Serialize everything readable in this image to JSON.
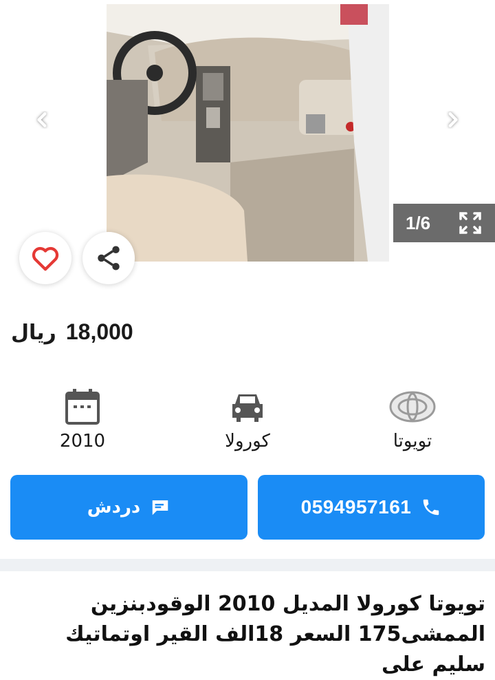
{
  "gallery": {
    "counter": "1/6",
    "photo_alt": "car-interior-photo"
  },
  "listing": {
    "price_value": "18,000",
    "price_currency": "ريال"
  },
  "specs": {
    "year": "2010",
    "model": "كورولا",
    "make": "تويوتا"
  },
  "actions": {
    "chat_label": "دردش",
    "phone_number": "0594957161"
  },
  "description": {
    "line1": "تويوتا كورولا المديل 2010 الوقودبنزين",
    "line2": "الممشى175 السعر 18الف القير اوتماتيك سليم على"
  },
  "colors": {
    "primary": "#1a8cf5",
    "counter_bg": "#6b6b6b",
    "heart": "#e53935"
  }
}
